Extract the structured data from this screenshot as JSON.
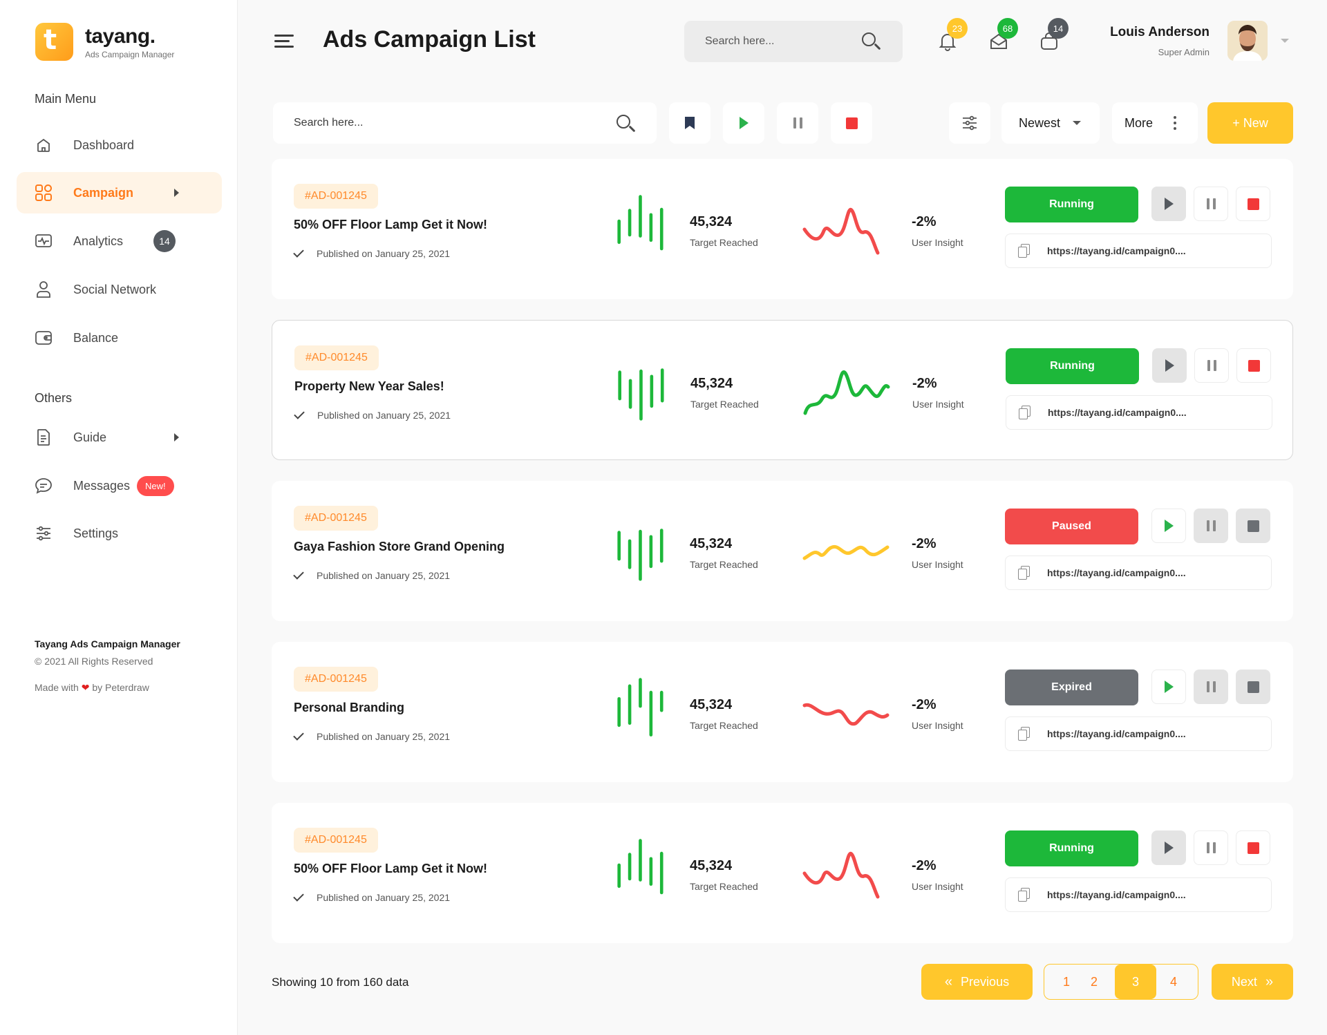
{
  "brand": {
    "name": "tayang.",
    "sub": "Ads Campaign Manager",
    "logo_letter": "t"
  },
  "sidebar": {
    "main_menu_title": "Main Menu",
    "others_title": "Others",
    "main_items": [
      {
        "label": "Dashboard",
        "icon": "home-icon"
      },
      {
        "label": "Campaign",
        "icon": "grid-icon",
        "active": true
      },
      {
        "label": "Analytics",
        "icon": "activity-icon",
        "badge": "14"
      },
      {
        "label": "Social Network",
        "icon": "user-icon"
      },
      {
        "label": "Balance",
        "icon": "wallet-icon"
      }
    ],
    "other_items": [
      {
        "label": "Guide",
        "icon": "document-icon"
      },
      {
        "label": "Messages",
        "icon": "chat-icon",
        "badge": "New!"
      },
      {
        "label": "Settings",
        "icon": "sliders-icon"
      }
    ],
    "footer": {
      "title": "Tayang Ads Campaign Manager",
      "copyright": "© 2021 All Rights Reserved",
      "made_prefix": "Made with",
      "made_suffix": "by Peterdraw"
    }
  },
  "header": {
    "title": "Ads Campaign List",
    "search_placeholder": "Search here...",
    "notifications": {
      "bell": "23",
      "mail": "68",
      "cart": "14"
    },
    "user": {
      "name": "Louis Anderson",
      "role": "Super Admin"
    }
  },
  "toolbar": {
    "search_placeholder": "Search here...",
    "sort_label": "Newest",
    "more_label": "More",
    "new_label": "+ New"
  },
  "campaigns": [
    {
      "id": "#AD-001245",
      "title": "50% OFF Floor Lamp Get it Now!",
      "published": "Published on January 25, 2021",
      "target_value": "45,324",
      "target_label": "Target Reached",
      "insight_value": "-2%",
      "insight_label": "User Insight",
      "status": "Running",
      "status_color": "#1db83a",
      "trend_color": "#f24b4b",
      "url": "https://tayang.id/campaign0...."
    },
    {
      "id": "#AD-001245",
      "title": "Property New Year Sales!",
      "published": "Published on January 25, 2021",
      "target_value": "45,324",
      "target_label": "Target Reached",
      "insight_value": "-2%",
      "insight_label": "User Insight",
      "status": "Running",
      "status_color": "#1db83a",
      "trend_color": "#1db83a",
      "url": "https://tayang.id/campaign0...."
    },
    {
      "id": "#AD-001245",
      "title": "Gaya Fashion Store Grand Opening",
      "published": "Published on January 25, 2021",
      "target_value": "45,324",
      "target_label": "Target Reached",
      "insight_value": "-2%",
      "insight_label": "User Insight",
      "status": "Paused",
      "status_color": "#f24b4b",
      "trend_color": "#ffc72c",
      "url": "https://tayang.id/campaign0...."
    },
    {
      "id": "#AD-001245",
      "title": "Personal Branding",
      "published": "Published on January 25, 2021",
      "target_value": "45,324",
      "target_label": "Target Reached",
      "insight_value": "-2%",
      "insight_label": "User Insight",
      "status": "Expired",
      "status_color": "#6b6f74",
      "trend_color": "#f24b4b",
      "url": "https://tayang.id/campaign0...."
    },
    {
      "id": "#AD-001245",
      "title": "50% OFF Floor Lamp Get it Now!",
      "published": "Published on January 25, 2021",
      "target_value": "45,324",
      "target_label": "Target Reached",
      "insight_value": "-2%",
      "insight_label": "User Insight",
      "status": "Running",
      "status_color": "#1db83a",
      "trend_color": "#f24b4b",
      "url": "https://tayang.id/campaign0...."
    }
  ],
  "pagination": {
    "showing": "Showing 10 from 160 data",
    "previous_label": "Previous",
    "next_label": "Next",
    "pages": [
      "1",
      "2",
      "3",
      "4"
    ],
    "current": "3"
  },
  "colors": {
    "accent": "#ffc72c",
    "orange": "#ff7a1a",
    "green": "#1db83a",
    "red": "#f24b4b"
  }
}
